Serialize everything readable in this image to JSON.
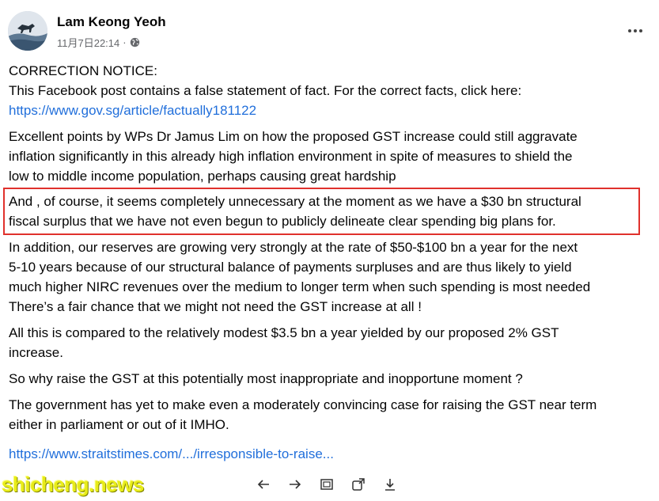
{
  "post": {
    "author": "Lam Keong Yeoh",
    "timestamp": "11月7日22:14",
    "separator": "·",
    "privacy_icon": "globe-icon",
    "more_icon": "more-options-icon"
  },
  "content": {
    "correction_title": "CORRECTION NOTICE:",
    "correction_text": "This Facebook post contains a false statement of fact. For the correct facts, click here:",
    "correction_link": "https://www.gov.sg/article/factually181122",
    "para1_l1": "Excellent points by WPs Dr Jamus Lim on how the proposed GST increase could still aggravate",
    "para1_l2": "inflation significantly in this already high inflation environment in spite of measures to shield the",
    "para1_l3": "low to middle income population, perhaps causing great hardship",
    "para2_l1": "And , of course, it seems completely unnecessary at the moment as we have a $30 bn structural",
    "para2_l2": "fiscal surplus that we have not even begun to publicly delineate clear spending big plans for.",
    "para3_l1": "In addition, our reserves are growing very strongly at the rate of $50-$100 bn a year for the next",
    "para3_l2": "5-10 years because of our structural balance of payments surpluses and are thus likely to yield",
    "para3_l3": "much higher NIRC revenues over the medium to longer term when such spending is most needed",
    "para3_l4": "There’s a fair chance that we might not need the GST increase at all !",
    "para4_l1": "All this is compared to the relatively modest $3.5 bn a year yielded by our proposed 2% GST",
    "para4_l2": "increase.",
    "para5": "So why raise the GST at this potentially most inappropriate and inopportune moment ?",
    "para6_l1": "The government has yet to make even a moderately convincing case for raising the GST near term",
    "para6_l2": "either in parliament or out of it IMHO.",
    "article_link": "https://www.straitstimes.com/.../irresponsible-to-raise..."
  },
  "watermark": "shicheng.news",
  "toolbar": {
    "icons": [
      "arrow-left-icon",
      "arrow-right-icon",
      "frame-icon",
      "share-icon",
      "download-icon"
    ]
  },
  "colors": {
    "link": "#216fdb",
    "highlight_border": "#e0312c",
    "watermark": "#e8ec1a",
    "meta_text": "#65676b"
  }
}
